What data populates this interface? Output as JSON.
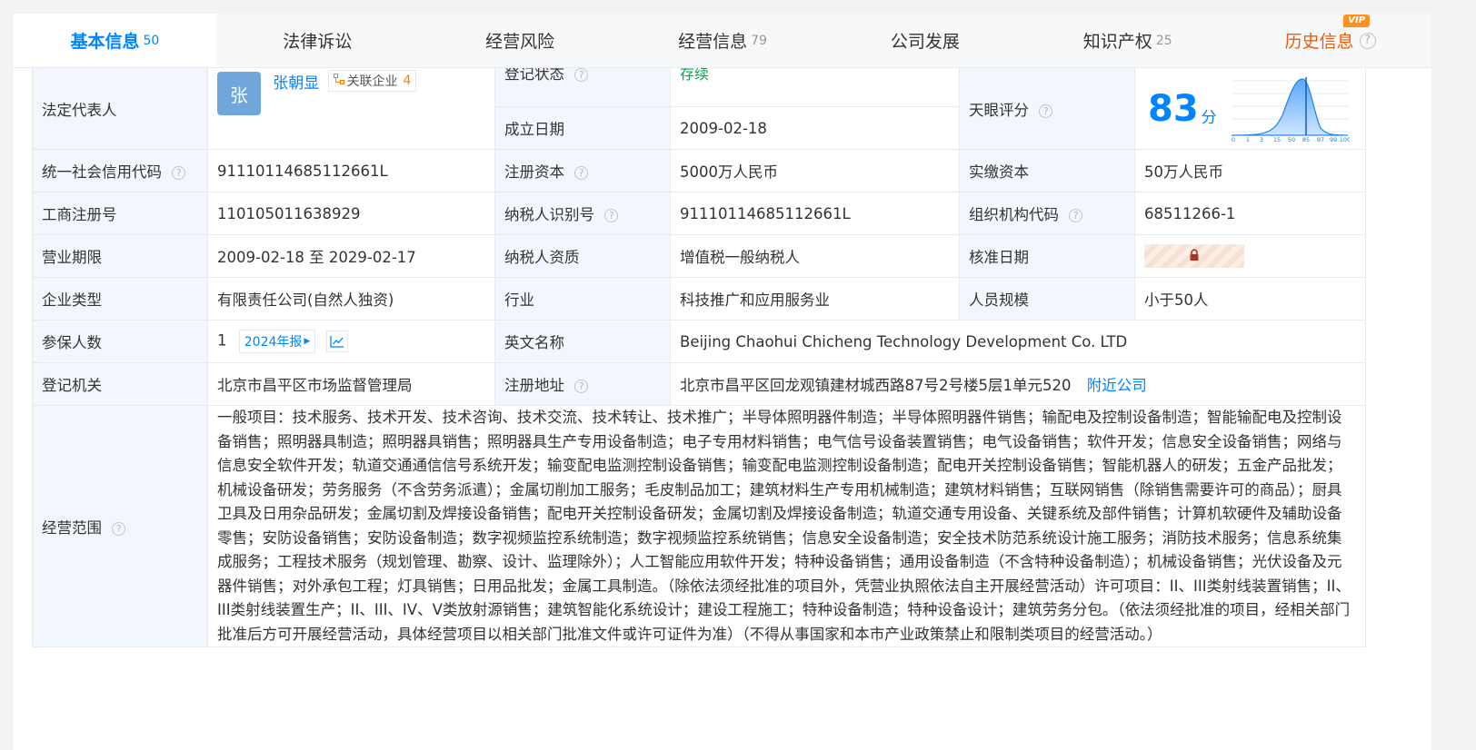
{
  "tabs": [
    {
      "label": "基本信息",
      "count": "50",
      "active": true
    },
    {
      "label": "法律诉讼",
      "count": ""
    },
    {
      "label": "经营风险",
      "count": ""
    },
    {
      "label": "经营信息",
      "count": "79"
    },
    {
      "label": "公司发展",
      "count": ""
    },
    {
      "label": "知识产权",
      "count": "25"
    },
    {
      "label": "历史信息",
      "count": "",
      "vip": "VIP"
    }
  ],
  "info": {
    "legal_rep_label": "法定代表人",
    "legal_rep_avatar": "张",
    "legal_rep_name": "张朝显",
    "related_label": "关联企业",
    "related_count": "4",
    "reg_status_label": "登记状态",
    "reg_status_value": "存续",
    "found_date_label": "成立日期",
    "found_date_value": "2009-02-18",
    "score_label": "天眼评分",
    "score_value": "83",
    "score_unit": "分",
    "score_ticks": [
      "0",
      "1",
      "3",
      "15",
      "50",
      "85",
      "97",
      "99",
      "100"
    ],
    "credit_code_label": "统一社会信用代码",
    "credit_code_value": "91110114685112661L",
    "reg_capital_label": "注册资本",
    "reg_capital_value": "5000万人民币",
    "paid_capital_label": "实缴资本",
    "paid_capital_value": "50万人民币",
    "biz_reg_no_label": "工商注册号",
    "biz_reg_no_value": "110105011638929",
    "taxpayer_id_label": "纳税人识别号",
    "taxpayer_id_value": "91110114685112661L",
    "org_code_label": "组织机构代码",
    "org_code_value": "68511266-1",
    "term_label": "营业期限",
    "term_value": "2009-02-18 至 2029-02-17",
    "taxpayer_qual_label": "纳税人资质",
    "taxpayer_qual_value": "增值税一般纳税人",
    "approve_date_label": "核准日期",
    "company_type_label": "企业类型",
    "company_type_value": "有限责任公司(自然人独资)",
    "industry_label": "行业",
    "industry_value": "科技推广和应用服务业",
    "staff_size_label": "人员规模",
    "staff_size_value": "小于50人",
    "insured_label": "参保人数",
    "insured_value": "1",
    "report_tag": "2024年报",
    "english_name_label": "英文名称",
    "english_name_value": "Beijing Chaohui Chicheng Technology Development Co. LTD",
    "reg_authority_label": "登记机关",
    "reg_authority_value": "北京市昌平区市场监督管理局",
    "reg_address_label": "注册地址",
    "reg_address_value": "北京市昌平区回龙观镇建材城西路87号2号楼5层1单元520",
    "nearby_link": "附近公司",
    "scope_label": "经营范围",
    "scope_value": "一般项目：技术服务、技术开发、技术咨询、技术交流、技术转让、技术推广；半导体照明器件制造；半导体照明器件销售；输配电及控制设备制造；智能输配电及控制设备销售；照明器具制造；照明器具销售；照明器具生产专用设备制造；电子专用材料销售；电气信号设备装置销售；电气设备销售；软件开发；信息安全设备销售；网络与信息安全软件开发；轨道交通通信信号系统开发；输变配电监测控制设备销售；输变配电监测控制设备制造；配电开关控制设备销售；智能机器人的研发；五金产品批发；机械设备研发；劳务服务（不含劳务派遣）；金属切削加工服务；毛皮制品加工；建筑材料生产专用机械制造；建筑材料销售；互联网销售（除销售需要许可的商品）；厨具卫具及日用杂品研发；金属切割及焊接设备销售；配电开关控制设备研发；金属切割及焊接设备制造；轨道交通专用设备、关键系统及部件销售；计算机软硬件及辅助设备零售；安防设备销售；安防设备制造；数字视频监控系统制造；数字视频监控系统销售；信息安全设备制造；安全技术防范系统设计施工服务；消防技术服务；信息系统集成服务；工程技术服务（规划管理、勘察、设计、监理除外）；人工智能应用软件开发；特种设备销售；通用设备制造（不含特种设备制造）；机械设备销售；光伏设备及元器件销售；对外承包工程；灯具销售；日用品批发；金属工具制造。（除依法须经批准的项目外，凭营业执照依法自主开展经营活动）许可项目：II、III类射线装置销售；II、III类射线装置生产；II、III、IV、V类放射源销售；建筑智能化系统设计；建设工程施工；特种设备制造；特种设备设计；建筑劳务分包。（依法须经批准的项目，经相关部门批准后方可开展经营活动，具体经营项目以相关部门批准文件或许可证件为准）（不得从事国家和本市产业政策禁止和限制类项目的经营活动。）"
  },
  "colors": {
    "accent": "#0084ff",
    "history": "#e85d0c",
    "status_green": "#00a854",
    "label_bg": "#f2f7fd"
  }
}
